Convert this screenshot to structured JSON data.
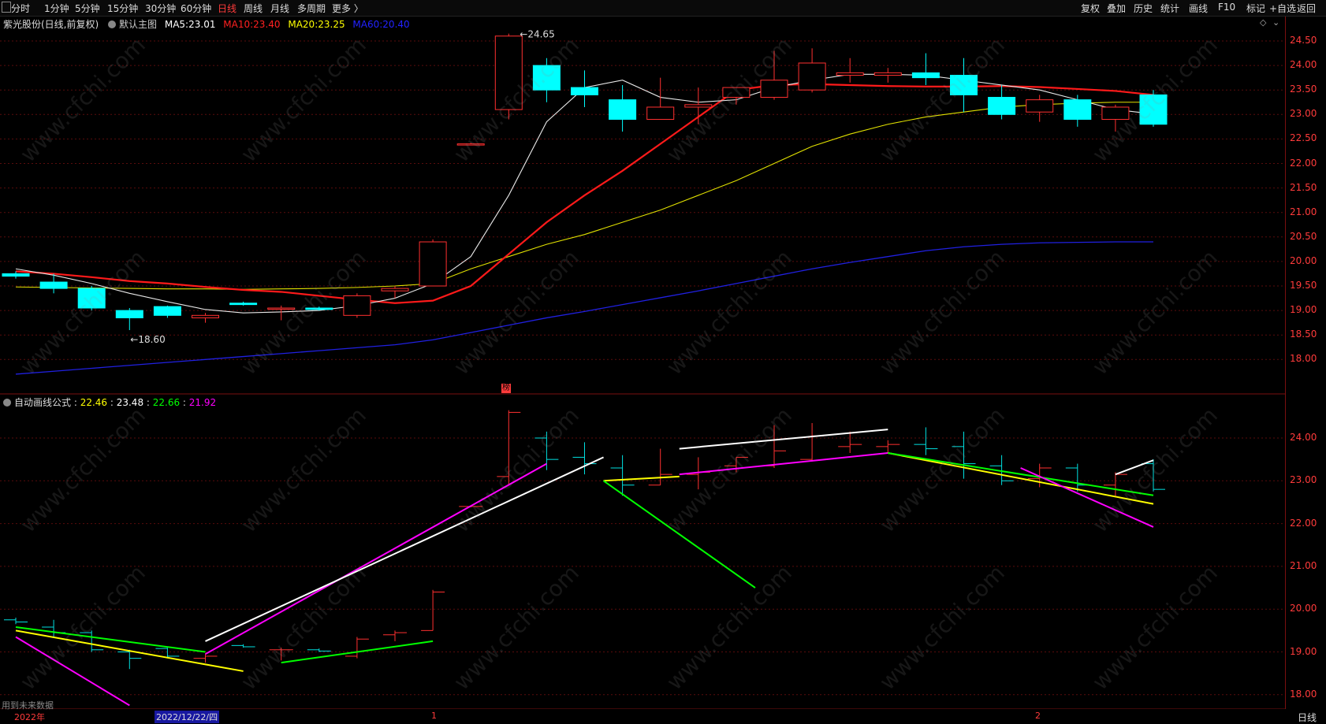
{
  "toolbar": {
    "left": [
      {
        "label": "分时",
        "active": false
      },
      {
        "label": "1分钟",
        "active": false
      },
      {
        "label": "5分钟",
        "active": false
      },
      {
        "label": "15分钟",
        "active": false
      },
      {
        "label": "30分钟",
        "active": false
      },
      {
        "label": "60分钟",
        "active": false
      },
      {
        "label": "日线",
        "active": true
      },
      {
        "label": "周线",
        "active": false
      },
      {
        "label": "月线",
        "active": false
      },
      {
        "label": "多周期",
        "active": false
      },
      {
        "label": "更多 〉",
        "active": false
      }
    ],
    "right": [
      "复权",
      "叠加",
      "历史",
      "统计",
      "画线",
      "F10",
      "标记",
      "+自选",
      "返回"
    ]
  },
  "main_chart": {
    "stock_title": "紫光股份(日线,前复权)",
    "template": "默认主图",
    "ma5": {
      "label": "MA5:",
      "value": "23.01",
      "color": "#ffffff"
    },
    "ma10": {
      "label": "MA10:",
      "value": "23.40",
      "color": "#ff2020"
    },
    "ma20": {
      "label": "MA20:",
      "value": "23.25",
      "color": "#ffff00"
    },
    "ma60": {
      "label": "MA60:",
      "value": "20.40",
      "color": "#2222ff"
    },
    "high_label": "24.65",
    "low_label": "18.60",
    "bang_badge": "榜",
    "y_ticks": [
      "24.50",
      "24.00",
      "23.50",
      "23.00",
      "22.50",
      "22.00",
      "21.50",
      "21.00",
      "20.50",
      "20.00",
      "19.50",
      "19.00",
      "18.50",
      "18.00"
    ]
  },
  "sub_chart": {
    "title": "自动画线公式",
    "values": [
      {
        "v": "22.46",
        "color": "#ffff00"
      },
      {
        "v": "23.48",
        "color": "#ffffff"
      },
      {
        "v": "22.66",
        "color": "#00ff00"
      },
      {
        "v": "21.92",
        "color": "#ff00ff"
      }
    ],
    "y_ticks": [
      "24.00",
      "23.00",
      "22.00",
      "21.00",
      "20.00",
      "19.00",
      "18.00"
    ],
    "future_note": "用到未来数据"
  },
  "footer": {
    "year_label": "2022年",
    "date_label": "2022/12/22/四",
    "month1": "1",
    "month2": "2",
    "period": "日线"
  },
  "watermark": "www.cfchi.com",
  "chart_data": {
    "type": "candlestick",
    "dates_note": "",
    "candles": [
      {
        "o": 19.75,
        "h": 19.8,
        "l": 19.65,
        "c": 19.7
      },
      {
        "o": 19.58,
        "h": 19.75,
        "l": 19.35,
        "c": 19.45
      },
      {
        "o": 19.45,
        "h": 19.5,
        "l": 19.0,
        "c": 19.05
      },
      {
        "o": 19.0,
        "h": 19.05,
        "l": 18.6,
        "c": 18.85
      },
      {
        "o": 19.08,
        "h": 19.1,
        "l": 18.85,
        "c": 18.9
      },
      {
        "o": 18.85,
        "h": 18.95,
        "l": 18.75,
        "c": 18.9
      },
      {
        "o": 19.15,
        "h": 19.18,
        "l": 19.1,
        "c": 19.12
      },
      {
        "o": 19.05,
        "h": 19.1,
        "l": 18.8,
        "c": 19.05
      },
      {
        "o": 19.05,
        "h": 19.08,
        "l": 19.0,
        "c": 19.02
      },
      {
        "o": 18.9,
        "h": 19.35,
        "l": 18.85,
        "c": 19.3
      },
      {
        "o": 19.4,
        "h": 19.5,
        "l": 19.25,
        "c": 19.45
      },
      {
        "o": 19.5,
        "h": 20.45,
        "l": 19.5,
        "c": 20.4
      },
      {
        "o": 22.4,
        "h": 22.42,
        "l": 22.38,
        "c": 22.4
      },
      {
        "o": 23.1,
        "h": 24.65,
        "l": 22.9,
        "c": 24.6
      },
      {
        "o": 24.0,
        "h": 24.15,
        "l": 23.25,
        "c": 23.5
      },
      {
        "o": 23.55,
        "h": 23.9,
        "l": 23.15,
        "c": 23.4
      },
      {
        "o": 23.3,
        "h": 23.6,
        "l": 22.65,
        "c": 22.9
      },
      {
        "o": 22.9,
        "h": 23.75,
        "l": 22.9,
        "c": 23.15
      },
      {
        "o": 23.15,
        "h": 23.55,
        "l": 22.8,
        "c": 23.2
      },
      {
        "o": 23.35,
        "h": 23.55,
        "l": 23.2,
        "c": 23.55
      },
      {
        "o": 23.35,
        "h": 24.3,
        "l": 23.3,
        "c": 23.7
      },
      {
        "o": 23.5,
        "h": 24.35,
        "l": 23.45,
        "c": 24.05
      },
      {
        "o": 23.8,
        "h": 24.15,
        "l": 23.65,
        "c": 23.85
      },
      {
        "o": 23.8,
        "h": 23.95,
        "l": 23.65,
        "c": 23.85
      },
      {
        "o": 23.85,
        "h": 24.25,
        "l": 23.6,
        "c": 23.75
      },
      {
        "o": 23.8,
        "h": 24.15,
        "l": 23.05,
        "c": 23.4
      },
      {
        "o": 23.35,
        "h": 23.6,
        "l": 22.9,
        "c": 23.0
      },
      {
        "o": 23.05,
        "h": 23.4,
        "l": 22.85,
        "c": 23.3
      },
      {
        "o": 23.3,
        "h": 23.4,
        "l": 22.75,
        "c": 22.9
      },
      {
        "o": 22.9,
        "h": 23.2,
        "l": 22.65,
        "c": 23.15
      },
      {
        "o": 23.4,
        "h": 23.5,
        "l": 22.75,
        "c": 22.8
      }
    ],
    "ma5": [
      19.85,
      19.72,
      19.55,
      19.35,
      19.18,
      19.02,
      18.95,
      18.97,
      19.0,
      19.1,
      19.25,
      19.55,
      20.1,
      21.35,
      22.85,
      23.55,
      23.7,
      23.35,
      23.25,
      23.3,
      23.55,
      23.7,
      23.82,
      23.82,
      23.8,
      23.7,
      23.6,
      23.5,
      23.3,
      23.1,
      23.01
    ],
    "ma10": [
      19.8,
      19.75,
      19.68,
      19.6,
      19.55,
      19.48,
      19.42,
      19.38,
      19.3,
      19.22,
      19.15,
      19.2,
      19.5,
      20.15,
      20.8,
      21.35,
      21.85,
      22.4,
      22.95,
      23.5,
      23.6,
      23.62,
      23.6,
      23.58,
      23.57,
      23.57,
      23.58,
      23.56,
      23.52,
      23.48,
      23.4
    ],
    "ma20": [
      19.48,
      19.47,
      19.46,
      19.45,
      19.44,
      19.44,
      19.43,
      19.44,
      19.45,
      19.47,
      19.5,
      19.55,
      19.85,
      20.1,
      20.35,
      20.55,
      20.8,
      21.05,
      21.35,
      21.65,
      22.0,
      22.35,
      22.6,
      22.8,
      22.95,
      23.05,
      23.15,
      23.2,
      23.23,
      23.25,
      23.25
    ],
    "ma60": [
      17.7,
      17.76,
      17.82,
      17.88,
      17.94,
      18.0,
      18.06,
      18.12,
      18.18,
      18.24,
      18.3,
      18.4,
      18.55,
      18.7,
      18.85,
      18.98,
      19.12,
      19.26,
      19.4,
      19.55,
      19.7,
      19.85,
      19.98,
      20.1,
      20.22,
      20.3,
      20.35,
      20.38,
      20.39,
      20.4,
      20.4
    ]
  }
}
